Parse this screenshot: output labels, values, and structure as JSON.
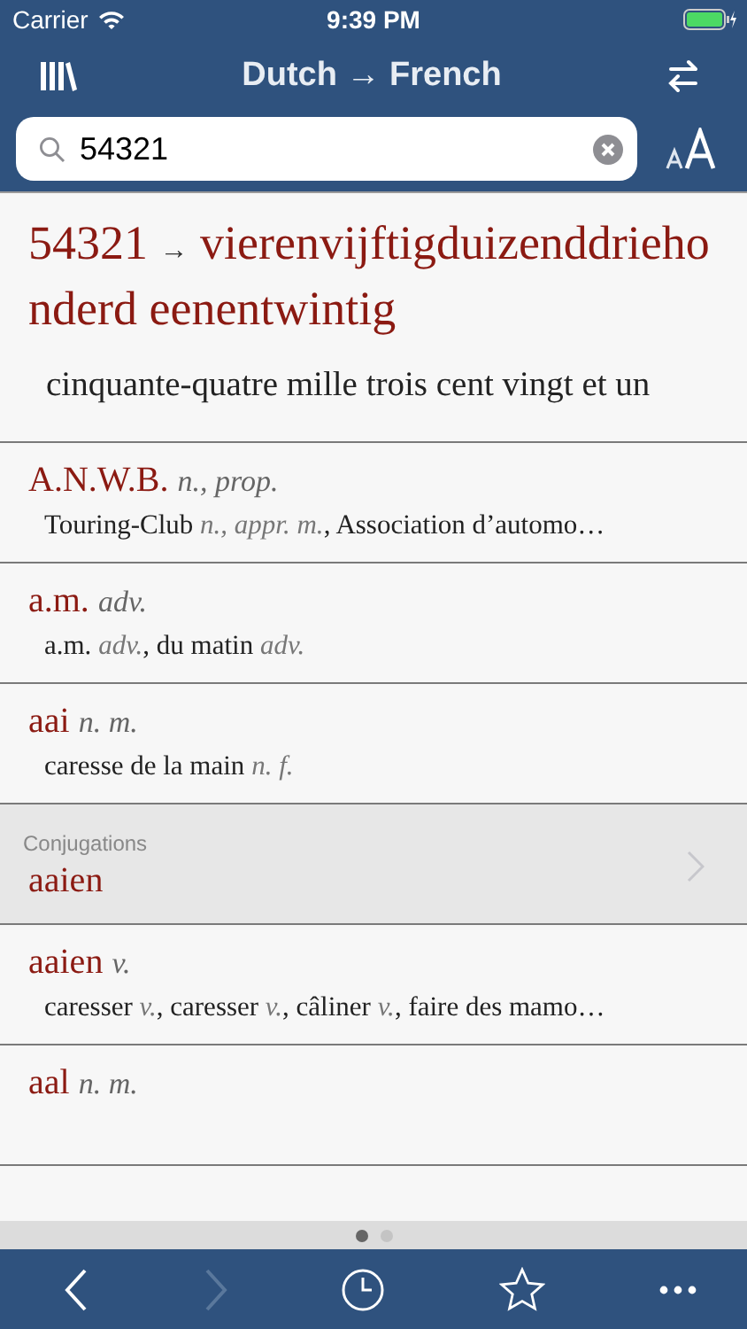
{
  "status_bar": {
    "carrier": "Carrier",
    "time": "9:39 PM"
  },
  "nav": {
    "title": "Dutch → French"
  },
  "search": {
    "value": "54321"
  },
  "main_entry": {
    "number": "54321",
    "arrow": "→",
    "words": "vierenvijftigduizenddriehonderd eenentwintig",
    "translation": "cinquante-quatre mille trois cent vingt et un"
  },
  "entries": [
    {
      "kind": "entry",
      "head": "A.N.W.B.",
      "grammar": "n., prop.",
      "translation": "Touring-Club *n., appr. m.*, Association d’automo…"
    },
    {
      "kind": "entry",
      "head": "a.m.",
      "grammar": "adv.",
      "translation": "a.m. *adv.*, du matin *adv.*"
    },
    {
      "kind": "entry",
      "head": "aai",
      "grammar": "n. m.",
      "translation": "caresse de la main *n. f.*"
    },
    {
      "kind": "conjugation",
      "label": "Conjugations",
      "head": "aaien"
    },
    {
      "kind": "entry",
      "head": "aaien",
      "grammar": "v.",
      "translation": "caresser *v.*, caresser *v.*, câliner *v.*, faire des mamo…"
    },
    {
      "kind": "entry",
      "head": "aal",
      "grammar": "n. m."
    }
  ],
  "page_dots": [
    {
      "selected": true
    },
    {
      "selected": false
    }
  ],
  "toolbar": {
    "back_disabled": false,
    "forward_disabled": true
  }
}
